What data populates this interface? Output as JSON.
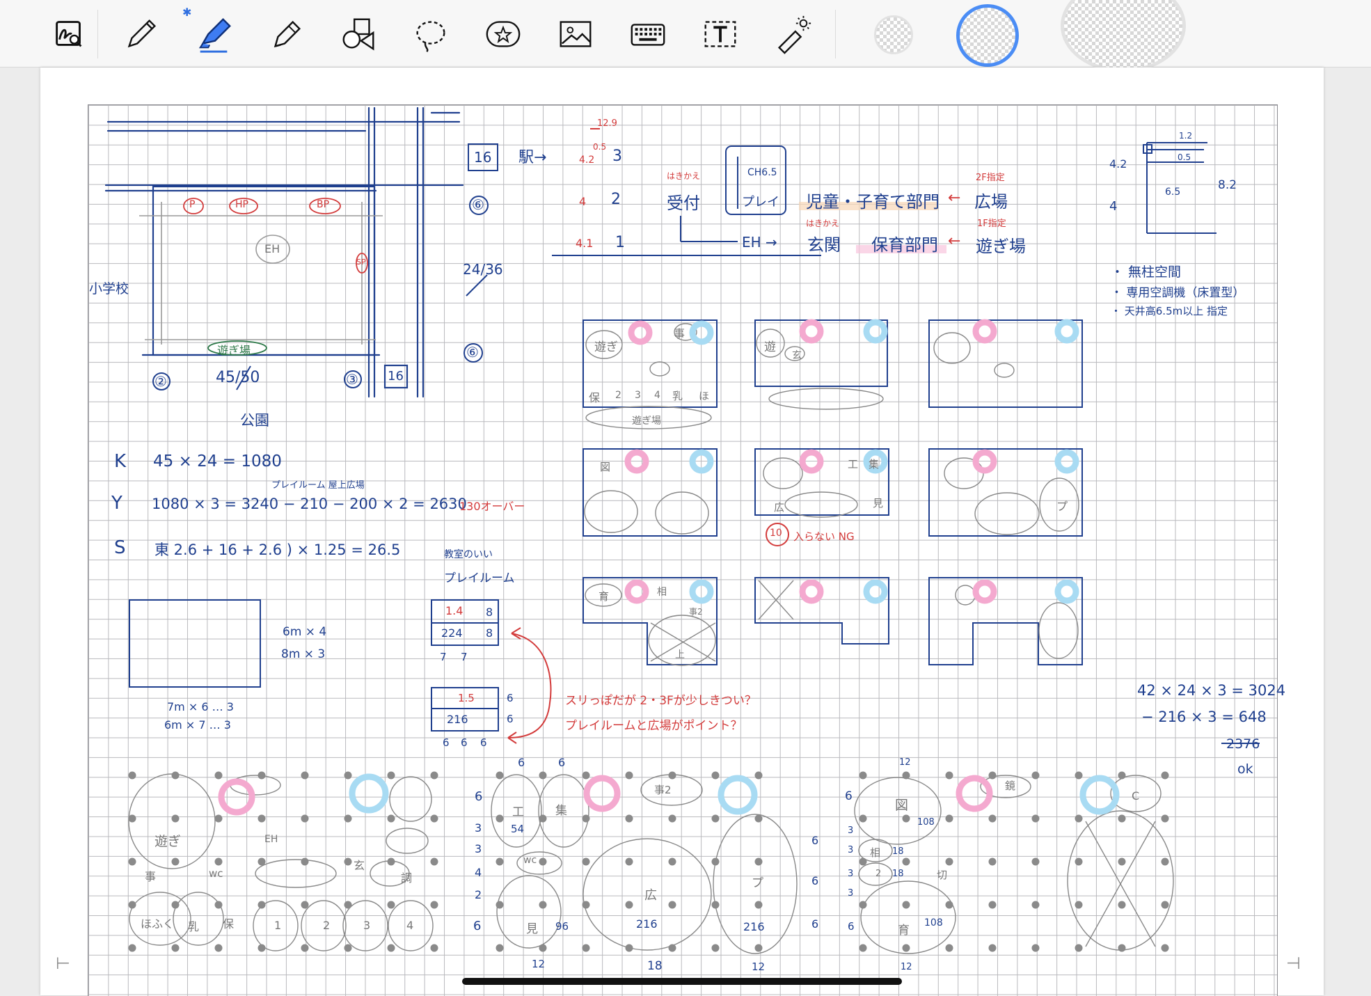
{
  "colors": {
    "ink_blue": "#1f3f8e",
    "ink_red": "#d33b3b",
    "highlight_pink": "#f4a9cf",
    "highlight_blue": "#a8dbf3",
    "accent_blue": "#2f6fe0"
  },
  "toolbar": {
    "tools": [
      {
        "name": "lasso-zoom-icon"
      },
      {
        "name": "pen-icon"
      },
      {
        "name": "highlighter-icon",
        "active": true
      },
      {
        "name": "marker-icon"
      },
      {
        "name": "shapes-icon"
      },
      {
        "name": "lasso-icon"
      },
      {
        "name": "sticker-icon"
      },
      {
        "name": "image-icon"
      },
      {
        "name": "keyboard-icon"
      },
      {
        "name": "text-box-icon"
      },
      {
        "name": "laser-pointer-icon"
      }
    ],
    "bluetooth_icon": "bluetooth-icon"
  },
  "notes": {
    "left_plan": {
      "school": "小学校",
      "park": "公園",
      "circle_p": "P",
      "circle_hp": "HP",
      "circle_bp": "BP",
      "circle_sp": "SP",
      "eh": "EH",
      "playground": "遊ぎ場",
      "n2": "②",
      "n3": "③",
      "dim": "45/50",
      "n16": "16"
    },
    "mid_top": {
      "n16": "16",
      "station": "駅→",
      "n6a": "⑥",
      "ratio": "24/36",
      "n6b": "⑥"
    },
    "section": {
      "r1": "12.9",
      "r2": "0.5",
      "r3": "4.2",
      "floor3": "3",
      "f4a": "4",
      "floor2": "2",
      "f4b": "4.1",
      "floor1": "1",
      "reception_note": "はきかえ",
      "reception": "受付",
      "ch": "CH6.5",
      "play": "プレイ",
      "child_dept": "児童・子育て部門",
      "arrow1": "←",
      "plaza": "広場",
      "plaza_note": "2F指定",
      "eh": "EH →",
      "entrance_note": "はきかえ",
      "entrance": "玄関",
      "nursery": "保育部門",
      "arrow2": "←",
      "play_area": "遊ぎ場",
      "play_area_note": "1F指定"
    },
    "right_top": {
      "h1": "4.2",
      "h2": "4",
      "d1": "1.2",
      "d2": "0.5",
      "d3": "6.5",
      "d4": "8.2",
      "bullet1": "・ 無柱空間",
      "bullet2": "・ 専用空調機（床置型）",
      "bullet3": "・ 天井高6.5m以上 指定"
    },
    "calc": {
      "k_label": "K",
      "k_eq": "45 × 24 = 1080",
      "y_note": "プレイルーム  屋上広場",
      "y_label": "Y",
      "y_eq": "1080 × 3 = 3240 − 210 − 200 × 2 = 2630",
      "y_over": "130オーバー",
      "s_label": "S",
      "s_eq": "東 2.6 + 16 + 2.6 ) × 1.25 = 26.5"
    },
    "room_box": {
      "a": "6m × 4",
      "b": "8m × 3",
      "c": "7m × 6 … 3",
      "d": "6m × 7 … 3"
    },
    "play_room": {
      "title1": "教室のいい",
      "title2": "プレイルーム",
      "v1": "1.4",
      "v2": "8",
      "v3": "224",
      "v4": "8",
      "v5": "7",
      "v6": "7",
      "v7": "1.5",
      "v8": "6",
      "v9": "216",
      "v10": "6",
      "v11": "6",
      "v12": "6",
      "v13": "6",
      "q1": "スリっぽだが 2・3Fが少しきつい？",
      "q2": "プレイルームと広場がポイント？"
    },
    "right_calc": {
      "line1": "42 × 24 × 3 = 3024",
      "line2": "− 216 × 3 = 648",
      "line3": "2376",
      "line4": "ok"
    },
    "schemes": {
      "s1": "遊ぎ",
      "s2": "事",
      "s3": "保",
      "s4": "2",
      "s5": "3",
      "s6": "4",
      "s7": "乳",
      "s8": "ほ",
      "s9": "遊ぎ場",
      "s10": "遊",
      "s11": "玄",
      "s12": "図",
      "s13": "工",
      "s14": "集",
      "s15": "広",
      "s16": "プ",
      "s17": "10",
      "s18": "入らない NG",
      "s19": "育",
      "s20": "相",
      "s21": "事2",
      "s22": "上",
      "s23": "見"
    },
    "bottom": {
      "b1": "遊ぎ",
      "b2": "EH",
      "b3": "事",
      "b4": "wc",
      "b5": "玄",
      "b6": "調",
      "b7": "ほふく",
      "b8": "乳",
      "b9": "保",
      "b10": "1",
      "b11": "2",
      "b12": "3",
      "b13": "4",
      "m1": "6",
      "m2": "6",
      "m3": "6",
      "m4": "工",
      "m5": "集",
      "m6": "事2",
      "m7": "3",
      "m8": "54",
      "m9": "3",
      "m10": "wc",
      "m11": "4",
      "m12": "2",
      "m13": "6",
      "m14": "見",
      "m15": "96",
      "m16": "広",
      "m17": "216",
      "m18": "プ",
      "m19": "216",
      "m20": "6",
      "m21": "6",
      "m22": "6",
      "m23": "12",
      "m24": "18",
      "m25": "12",
      "r1": "12",
      "r2": "6",
      "r3": "図",
      "r4": "108",
      "r5": "鏡",
      "r6": "3",
      "r7": "相",
      "r8": "18",
      "r9": "3",
      "r10": "2",
      "r11": "18",
      "r12": "3",
      "r13": "3",
      "r14": "6",
      "r15": "育",
      "r16": "108",
      "r17": "12",
      "r18": "切",
      "r19": "C"
    }
  }
}
